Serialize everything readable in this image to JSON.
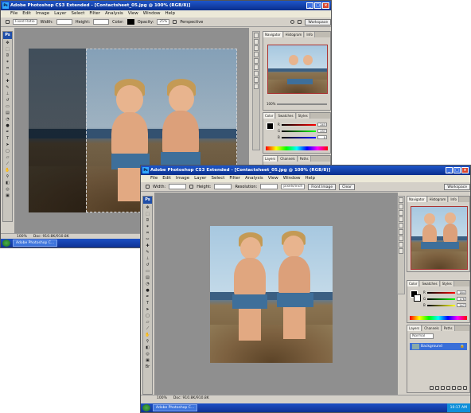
{
  "window_back": {
    "title": "Adobe Photoshop CS3 Extended - [Contactsheet_05.jpg @ 100% (RGB/8)]",
    "menu": [
      "File",
      "Edit",
      "Image",
      "Layer",
      "Select",
      "Filter",
      "Analysis",
      "View",
      "Window",
      "Help"
    ],
    "options": {
      "mode_label": "Fixed Ratio",
      "width_label": "Width:",
      "height_label": "Height:",
      "color_label": "Color:",
      "opacity_label": "Opacity:",
      "opacity_value": "25%",
      "perspective_label": "Perspective",
      "workspace_label": "Workspace"
    },
    "status": {
      "zoom": "100%",
      "doc": "Doc: 910.8K/910.8K"
    },
    "navigator_zoom": "100%",
    "color_values": {
      "r": "243",
      "g": "237",
      "b": "0"
    },
    "navigator_tabs": [
      "Navigator",
      "Histogram",
      "Info"
    ],
    "color_tabs": [
      "Color",
      "Swatches",
      "Styles"
    ],
    "layers_tabs": [
      "Layers",
      "Channels",
      "Paths"
    ],
    "taskbar_item": "Adobe Photoshop C..."
  },
  "window_front": {
    "title": "Adobe Photoshop CS3 Extended - [Contactsheet_05.jpg @ 100% (RGB/8)]",
    "menu": [
      "File",
      "Edit",
      "Image",
      "Layer",
      "Select",
      "Filter",
      "Analysis",
      "View",
      "Window",
      "Help"
    ],
    "options": {
      "width_label": "Width:",
      "height_label": "Height:",
      "resolution_label": "Resolution:",
      "resolution_unit": "pixels/inch",
      "front_image_button": "Front Image",
      "clear_button": "Clear",
      "workspace_label": "Workspace"
    },
    "status": {
      "zoom": "100%",
      "doc": "Doc: 910.8K/910.8K"
    },
    "navigator_tabs": [
      "Navigator",
      "Histogram",
      "Info"
    ],
    "color_tabs": [
      "Color",
      "Swatches",
      "Styles"
    ],
    "color_values": {
      "r": "184",
      "g": "176",
      "b": "247"
    },
    "layers_tabs": [
      "Layers",
      "Channels",
      "Paths"
    ],
    "layers_blend": "Normal",
    "layer_name": "Background",
    "taskbar_item": "Adobe Photoshop C...",
    "tray_time": "10:17 AM"
  },
  "colors": {
    "title_blue": "#0a2f8e",
    "canvas_gray": "#8f8f8f",
    "panel_gray": "#d4d0c8"
  }
}
